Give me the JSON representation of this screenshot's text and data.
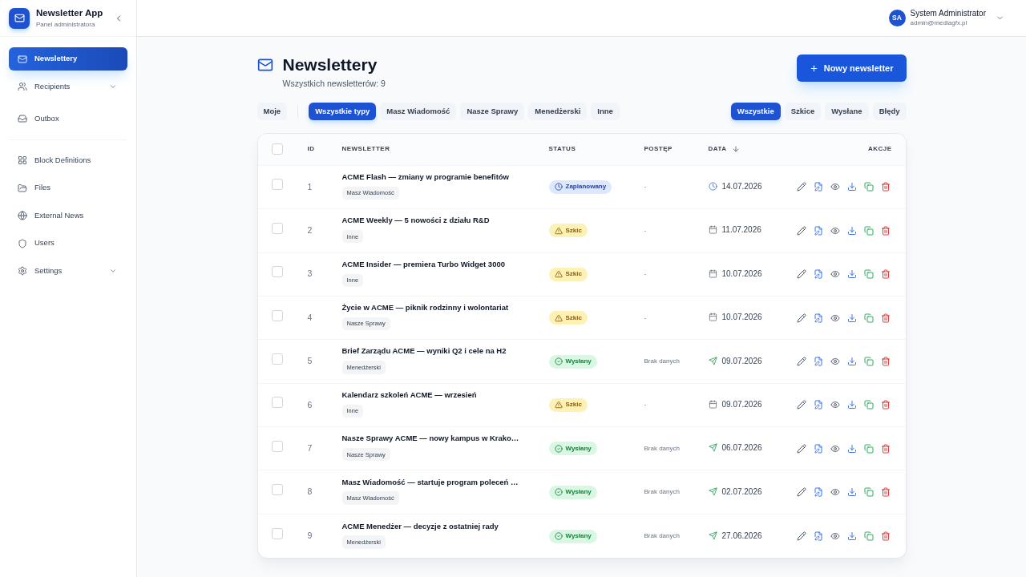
{
  "sidebar": {
    "app": {
      "title": "Newsletter App",
      "subtitle": "Panel administratora"
    },
    "nav_groups": [
      {
        "items": [
          {
            "label": "Newslettery",
            "selected": true,
            "expandable": false
          },
          {
            "label": "Recipients",
            "selected": false,
            "expandable": true
          },
          {
            "label": "Outbox",
            "selected": false,
            "expandable": false
          }
        ]
      },
      {
        "items": [
          {
            "label": "Block Definitions",
            "selected": false,
            "expandable": false
          },
          {
            "label": "Files",
            "selected": false,
            "expandable": false
          },
          {
            "label": "External News",
            "selected": false,
            "expandable": false
          },
          {
            "label": "Users",
            "selected": false,
            "expandable": false
          },
          {
            "label": "Settings",
            "selected": false,
            "expandable": true
          }
        ]
      }
    ]
  },
  "user": {
    "initials": "SA",
    "name": "System Administrator",
    "email": "admin@mediagfx.pl"
  },
  "page": {
    "title": "Newslettery",
    "subtitle": "Wszystkich newsletterów: 9",
    "new_button": "Nowy newsletter"
  },
  "owner_filter": {
    "label": "Moje",
    "selected": false
  },
  "type_filters": [
    {
      "label": "Wszystkie typy",
      "selected": true
    },
    {
      "label": "Masz Wiadomość",
      "selected": false
    },
    {
      "label": "Nasze Sprawy",
      "selected": false
    },
    {
      "label": "Menedżerski",
      "selected": false
    },
    {
      "label": "Inne",
      "selected": false
    }
  ],
  "status_filters": [
    {
      "label": "Wszystkie",
      "selected": true
    },
    {
      "label": "Szkice",
      "selected": false
    },
    {
      "label": "Wysłane",
      "selected": false
    },
    {
      "label": "Błędy",
      "selected": false
    }
  ],
  "table": {
    "header_checkbox": {
      "checked": false
    },
    "columns": [
      {
        "label": "ID",
        "sorted": false
      },
      {
        "label": "NEWSLETTER",
        "sorted": false
      },
      {
        "label": "STATUS",
        "sorted": false
      },
      {
        "label": "POSTĘP",
        "sorted": false
      },
      {
        "label": "DATA",
        "sorted": true
      },
      {
        "label": "AKCJE",
        "sorted": false
      }
    ],
    "rows": [
      {
        "checked": false,
        "id": "1",
        "title": "ACME Flash — zmiany w programie benefitów",
        "type": "Masz Wiadomość",
        "status": {
          "label": "Zaplanowany",
          "kind": "scheduled"
        },
        "progress": "-",
        "date": "14.07.2026"
      },
      {
        "checked": false,
        "id": "2",
        "title": "ACME Weekly — 5 nowości z działu R&D",
        "type": "Inne",
        "status": {
          "label": "Szkic",
          "kind": "draft"
        },
        "progress": "-",
        "date": "11.07.2026"
      },
      {
        "checked": false,
        "id": "3",
        "title": "ACME Insider — premiera Turbo Widget 3000",
        "type": "Inne",
        "status": {
          "label": "Szkic",
          "kind": "draft"
        },
        "progress": "-",
        "date": "10.07.2026"
      },
      {
        "checked": false,
        "id": "4",
        "title": "Życie w ACME — piknik rodzinny i wolontariat",
        "type": "Nasze Sprawy",
        "status": {
          "label": "Szkic",
          "kind": "draft"
        },
        "progress": "-",
        "date": "10.07.2026"
      },
      {
        "checked": false,
        "id": "5",
        "title": "Brief Zarządu ACME — wyniki Q2 i cele na H2",
        "type": "Menedżerski",
        "status": {
          "label": "Wysłany",
          "kind": "sent"
        },
        "progress": "Brak danych",
        "date": "09.07.2026"
      },
      {
        "checked": false,
        "id": "6",
        "title": "Kalendarz szkoleń ACME — wrzesień",
        "type": "Inne",
        "status": {
          "label": "Szkic",
          "kind": "draft"
        },
        "progress": "-",
        "date": "09.07.2026"
      },
      {
        "checked": false,
        "id": "7",
        "title": "Nasze Sprawy ACME — nowy kampus w Krako…",
        "type": "Nasze Sprawy",
        "status": {
          "label": "Wysłany",
          "kind": "sent"
        },
        "progress": "Brak danych",
        "date": "06.07.2026"
      },
      {
        "checked": false,
        "id": "8",
        "title": "Masz Wiadomość — startuje program poleceń …",
        "type": "Masz Wiadomość",
        "status": {
          "label": "Wysłany",
          "kind": "sent"
        },
        "progress": "Brak danych",
        "date": "02.07.2026"
      },
      {
        "checked": false,
        "id": "9",
        "title": "ACME Menedżer — decyzje z ostatniej rady",
        "type": "Menedżerski",
        "status": {
          "label": "Wysłany",
          "kind": "sent"
        },
        "progress": "Brak danych",
        "date": "27.06.2026"
      }
    ]
  }
}
